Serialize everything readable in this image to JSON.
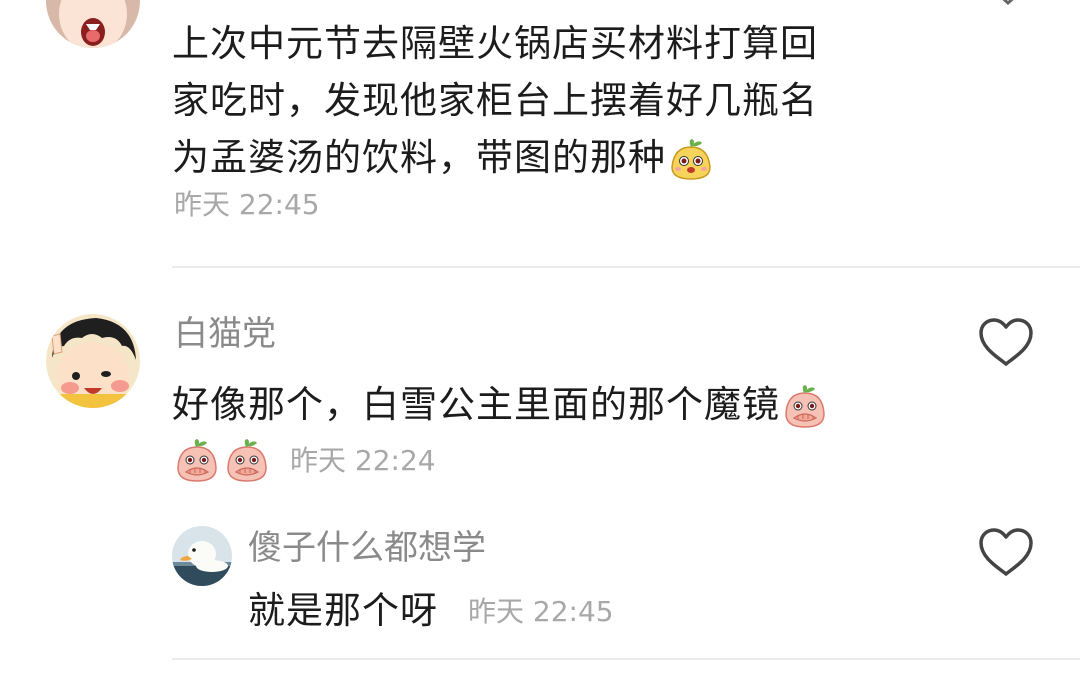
{
  "comments": [
    {
      "avatar_icon": "screaming-girl-avatar-icon",
      "body_lines": [
        "上次中元节去隔壁火锅店买材料打算回",
        "家吃时，发现他家柜台上摆着好几瓶名",
        "为孟婆汤的饮料，带图的那种"
      ],
      "body_emoji": "yellow-blob-emoji-icon",
      "timestamp": "昨天 22:45"
    },
    {
      "username": "白猫党",
      "avatar_icon": "cartoon-kid-avatar-icon",
      "body": "好像那个，白雪公主里面的那个魔镜",
      "body_emoji": "pink-peach-covering-mouth-emoji-icon",
      "trailing_emojis": [
        "pink-peach-covering-mouth-emoji-icon",
        "pink-peach-covering-mouth-emoji-icon"
      ],
      "timestamp": "昨天 22:24",
      "like_icon": "heart-outline-icon",
      "reply": {
        "username": "傻子什么都想学",
        "avatar_icon": "duck-avatar-icon",
        "body": "就是那个呀",
        "timestamp": "昨天 22:45",
        "like_icon": "heart-outline-icon"
      }
    }
  ],
  "colors": {
    "body_text": "#1c1c1c",
    "username": "#8a8a8a",
    "timestamp": "#a8a8a8",
    "divider": "#ececec",
    "heart_stroke": "#444444"
  }
}
